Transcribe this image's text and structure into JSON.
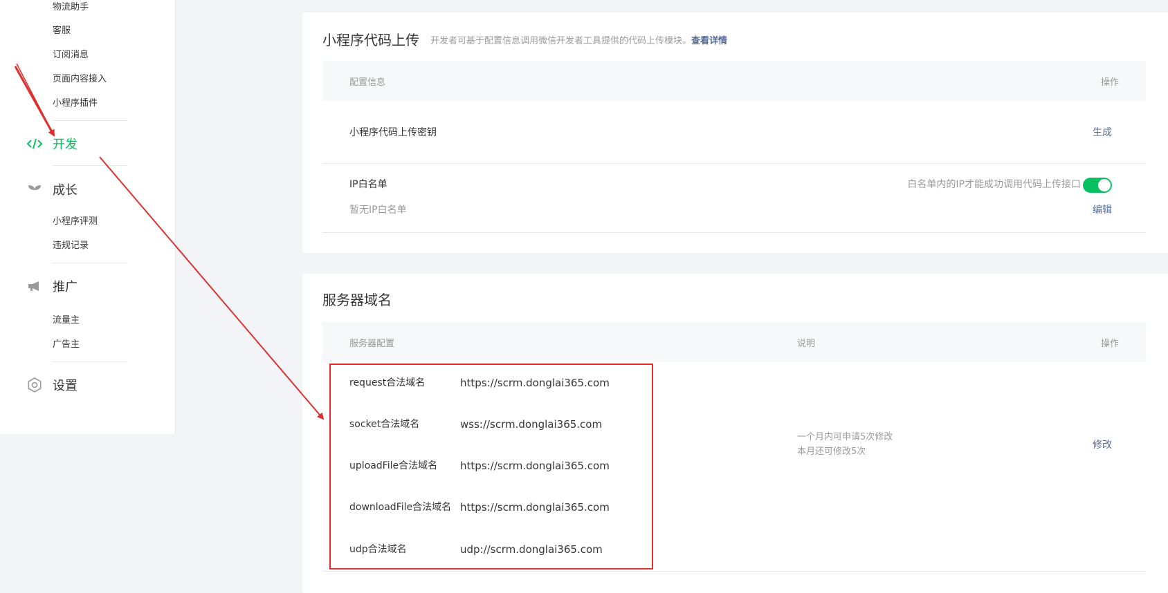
{
  "sidebar": {
    "top_items": [
      "物流助手",
      "客服",
      "订阅消息",
      "页面内容接入",
      "小程序插件"
    ],
    "sections": [
      {
        "label": "开发",
        "icon": "code-icon",
        "active": true
      },
      {
        "label": "成长",
        "icon": "sprout-icon",
        "active": false
      },
      {
        "label": "推广",
        "icon": "megaphone-icon",
        "active": false
      },
      {
        "label": "设置",
        "icon": "gear-icon",
        "active": false
      }
    ],
    "growth_items": [
      "小程序评测",
      "违规记录"
    ],
    "promo_items": [
      "流量主",
      "广告主"
    ]
  },
  "upload_card": {
    "title": "小程序代码上传",
    "desc": "开发者可基于配置信息调用微信开发者工具提供的代码上传模块。",
    "desc_link": "查看详情",
    "header_config": "配置信息",
    "header_action": "操作",
    "rows": {
      "secret_label": "小程序代码上传密钥",
      "secret_action": "生成",
      "ip_label": "IP白名单",
      "ip_empty": "暂无IP白名单",
      "ip_hint": "白名单内的IP才能成功调用代码上传接口",
      "ip_toggle_on": true,
      "ip_action": "编辑"
    }
  },
  "domain_card": {
    "title": "服务器域名",
    "header_config": "服务器配置",
    "header_desc": "说明",
    "header_action": "操作",
    "domains": [
      {
        "name": "request合法域名",
        "value": "https://scrm.donglai365.com"
      },
      {
        "name": "socket合法域名",
        "value": "wss://scrm.donglai365.com"
      },
      {
        "name": "uploadFile合法域名",
        "value": "https://scrm.donglai365.com"
      },
      {
        "name": "downloadFile合法域名",
        "value": "https://scrm.donglai365.com"
      },
      {
        "name": "udp合法域名",
        "value": "udp://scrm.donglai365.com"
      }
    ],
    "note_line1": "一个月内可申请5次修改",
    "note_line2": "本月还可修改5次",
    "action": "修改"
  },
  "colors": {
    "accent_green": "#07c160",
    "link_blue": "#576b95",
    "annotation_red": "#e02e2e"
  }
}
